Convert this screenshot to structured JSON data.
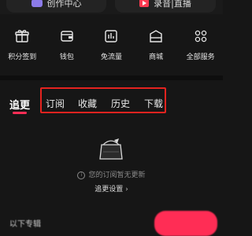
{
  "top": {
    "creator_center": "创作中心",
    "record_live": "录音|直播"
  },
  "services": [
    {
      "label": "积分签到",
      "icon": "gift-icon"
    },
    {
      "label": "钱包",
      "icon": "wallet-icon"
    },
    {
      "label": "免流量",
      "icon": "data-free-icon"
    },
    {
      "label": "商城",
      "icon": "shop-icon"
    },
    {
      "label": "全部服务",
      "icon": "grid-icon"
    }
  ],
  "tabs": {
    "active": "追更",
    "items": [
      "订阅",
      "收藏",
      "历史",
      "下载"
    ]
  },
  "empty": {
    "message": "您的订阅暂无更新",
    "settings_link": "追更设置"
  },
  "bottom": {
    "text": "以下专辑"
  },
  "colors": {
    "accent": "#ff2d55",
    "highlight": "#e5231f",
    "background": "#161616"
  }
}
